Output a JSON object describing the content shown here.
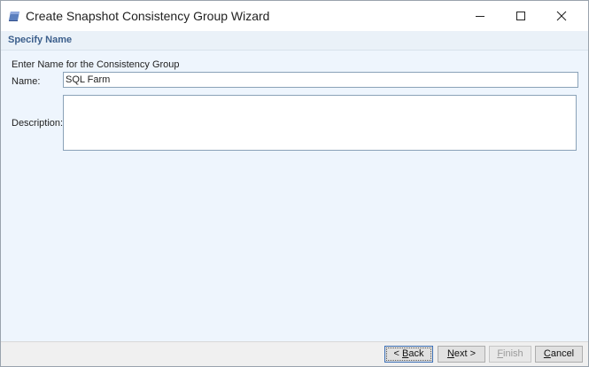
{
  "window": {
    "title": "Create Snapshot Consistency Group Wizard"
  },
  "step": {
    "title": "Specify Name"
  },
  "form": {
    "group_label": "Enter Name for the Consistency Group",
    "name_label": "Name:",
    "name_value": "SQL Farm",
    "description_label": "Description:",
    "description_value": ""
  },
  "buttons": {
    "back_prefix": "< ",
    "back_mnemonic": "B",
    "back_rest": "ack",
    "next_mnemonic": "N",
    "next_rest": "ext >",
    "finish_mnemonic": "F",
    "finish_rest": "inish",
    "cancel_mnemonic": "C",
    "cancel_rest": "ancel"
  },
  "colors": {
    "window_background": "#eef5fd",
    "step_title": "#3c5f8c",
    "focus_border": "#3c6fb5"
  },
  "icons": {
    "app": "snapshot-wizard-icon",
    "minimize": "minimize-icon",
    "maximize": "maximize-icon",
    "close": "close-icon"
  }
}
